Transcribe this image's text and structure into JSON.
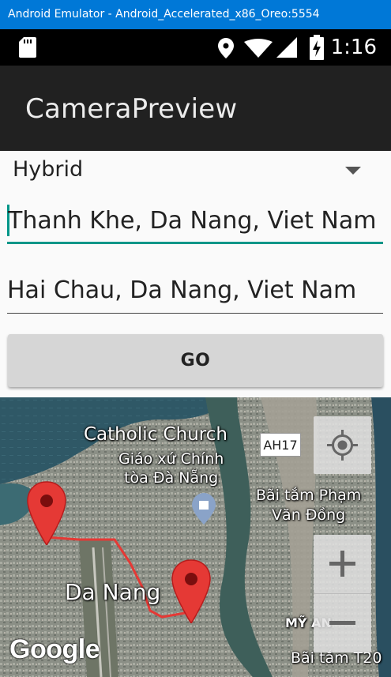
{
  "window": {
    "title": "Android Emulator - Android_Accelerated_x86_Oreo:5554"
  },
  "status_bar": {
    "time": "1:16",
    "icons": [
      "sd-card-icon",
      "location-icon",
      "wifi-icon",
      "signal-icon",
      "battery-charging-icon"
    ]
  },
  "app_bar": {
    "title": "CameraPreview"
  },
  "map_type_spinner": {
    "selected": "Hybrid"
  },
  "from_field": {
    "value": "Thanh Khe, Da Nang, Viet Nam"
  },
  "to_field": {
    "value": "Hai Chau, Da Nang, Viet Nam"
  },
  "go_button": {
    "label": "GO"
  },
  "map": {
    "labels": {
      "church": "Catholic Church",
      "church_local_1": "Giáo xứ Chính",
      "church_local_2": "tòa Đà Nẵng",
      "road_shield": "AH17",
      "beach_1": "Bãi tắm Phạm",
      "beach_2": "Văn Đồng",
      "city": "Da Nang",
      "district": "MỸ AN",
      "beach_t20": "Bãi tắm T20"
    },
    "controls": [
      "my-location-button",
      "zoom-in-button",
      "zoom-out-button"
    ],
    "route_color": "#e53935",
    "marker_color": "#e53935",
    "attribution": "Google"
  },
  "colors": {
    "accent": "#009688",
    "app_bar": "#212121",
    "title_bar": "#0078d7"
  }
}
